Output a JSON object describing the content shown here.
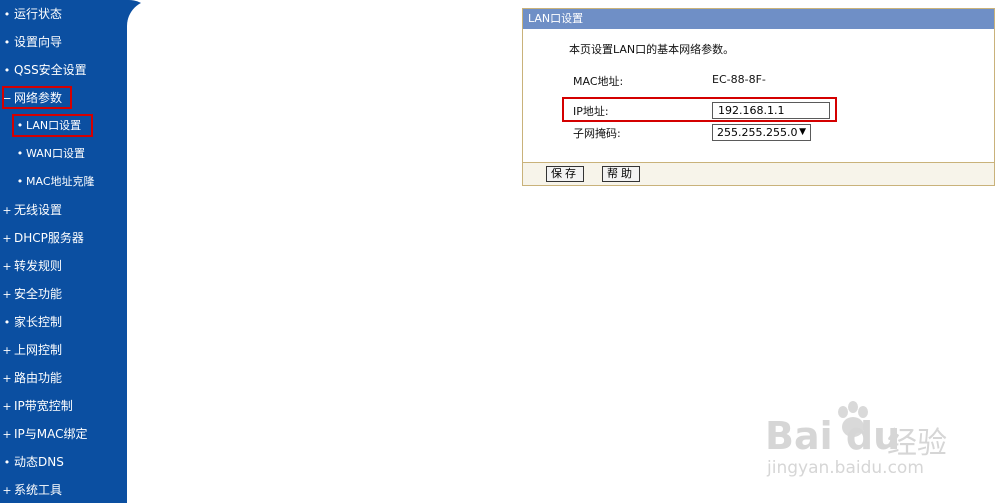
{
  "sidebar": {
    "items": [
      {
        "label": "运行状态",
        "bullet": "•"
      },
      {
        "label": "设置向导",
        "bullet": "•"
      },
      {
        "label": "QSS安全设置",
        "bullet": "•"
      },
      {
        "label": "网络参数",
        "bullet": "−"
      },
      {
        "label": "LAN口设置",
        "bullet": "•"
      },
      {
        "label": "WAN口设置",
        "bullet": "•"
      },
      {
        "label": "MAC地址克隆",
        "bullet": "•"
      },
      {
        "label": "无线设置",
        "bullet": "+"
      },
      {
        "label": "DHCP服务器",
        "bullet": "+"
      },
      {
        "label": "转发规则",
        "bullet": "+"
      },
      {
        "label": "安全功能",
        "bullet": "+"
      },
      {
        "label": "家长控制",
        "bullet": "•"
      },
      {
        "label": "上网控制",
        "bullet": "+"
      },
      {
        "label": "路由功能",
        "bullet": "+"
      },
      {
        "label": "IP带宽控制",
        "bullet": "+"
      },
      {
        "label": "IP与MAC绑定",
        "bullet": "+"
      },
      {
        "label": "动态DNS",
        "bullet": "•"
      },
      {
        "label": "系统工具",
        "bullet": "+"
      }
    ]
  },
  "panel": {
    "title": "LAN口设置",
    "description": "本页设置LAN口的基本网络参数。",
    "mac_label": "MAC地址:",
    "mac_value": "EC-88-8F-",
    "ip_label": "IP地址:",
    "ip_value": "192.168.1.1",
    "subnet_label": "子网掩码:",
    "subnet_value": "255.255.255.0",
    "save_label": "保存",
    "help_label": "帮助"
  },
  "watermark": {
    "brand": "Bai du",
    "brand_cn": "经验",
    "url": "jingyan.baidu.com"
  },
  "colors": {
    "sidebar": "#0b4fa1",
    "panel_title": "#6f8fc6",
    "highlight": "#d40000"
  }
}
